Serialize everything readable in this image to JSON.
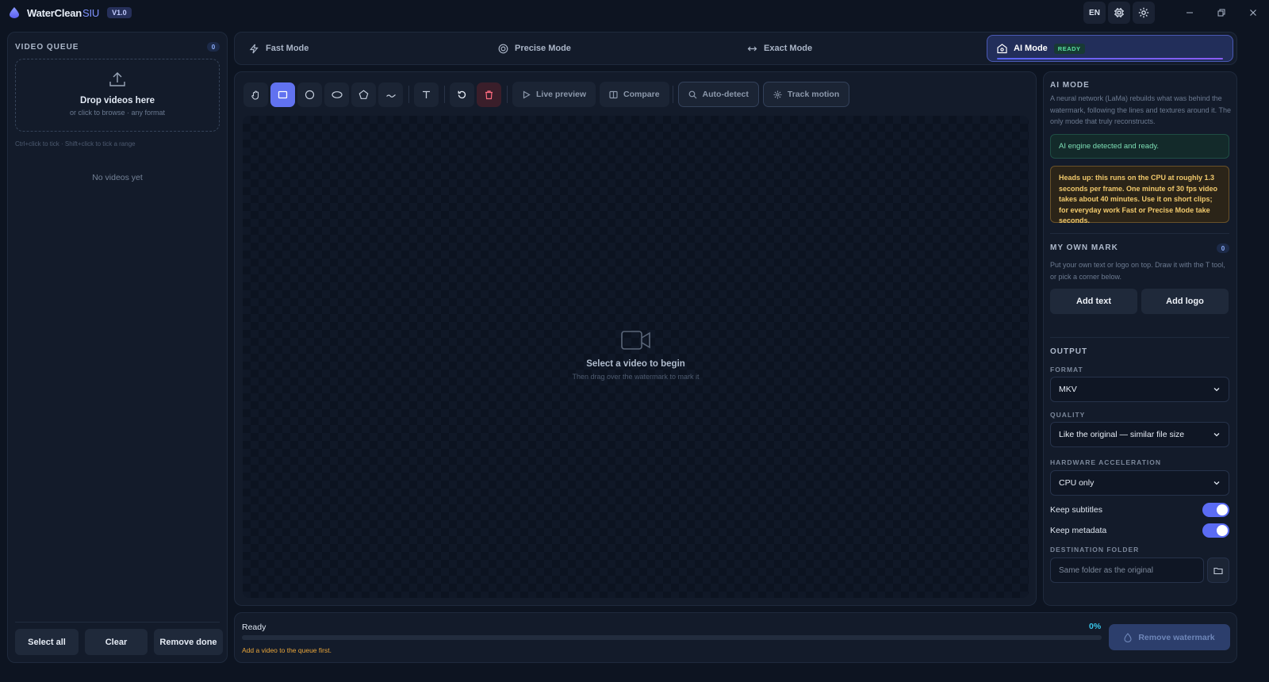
{
  "app": {
    "name": "WaterClean",
    "name_suffix": "SIU",
    "version": "V1.0",
    "language": "EN"
  },
  "queue": {
    "title": "VIDEO QUEUE",
    "count": "0",
    "drop_title": "Drop videos here",
    "drop_sub": "or click to browse · any format",
    "hint": "Ctrl+click to tick · Shift+click to tick a range",
    "empty": "No videos yet",
    "actions": {
      "select_all": "Select all",
      "clear": "Clear",
      "remove_done": "Remove done"
    }
  },
  "modes": {
    "fast": "Fast Mode",
    "precise": "Precise Mode",
    "exact": "Exact Mode",
    "ai": "AI Mode",
    "ai_badge": "READY"
  },
  "toolbar": {
    "live_preview": "Live preview",
    "compare": "Compare",
    "auto_detect": "Auto-detect",
    "track_motion": "Track motion"
  },
  "canvas": {
    "empty_title": "Select a video to begin",
    "empty_sub": "Then drag over the watermark to mark it"
  },
  "settings": {
    "ai_mode": {
      "title": "AI MODE",
      "description": "A neural network (LaMa) rebuilds what was behind the watermark, following the lines and textures around it. The only mode that truly reconstructs.",
      "status": "AI engine detected and ready.",
      "warning": "Heads up: this runs on the CPU at roughly 1.3 seconds per frame. One minute of 30 fps video takes about 40 minutes. Use it on short clips; for everyday work Fast or Precise Mode take seconds."
    },
    "own_mark": {
      "title": "MY OWN MARK",
      "count": "0",
      "description": "Put your own text or logo on top. Draw it with the T tool, or pick a corner below.",
      "add_text": "Add text",
      "add_logo": "Add logo"
    },
    "output": {
      "title": "OUTPUT",
      "format_label": "FORMAT",
      "format_value": "MKV",
      "quality_label": "QUALITY",
      "quality_value": "Like the original — similar file size",
      "hw_label": "HARDWARE ACCELERATION",
      "hw_value": "CPU only",
      "keep_subtitles": "Keep subtitles",
      "keep_metadata": "Keep metadata",
      "dest_label": "DESTINATION FOLDER",
      "dest_placeholder": "Same folder as the original"
    }
  },
  "status": {
    "text": "Ready",
    "percent": "0%",
    "progress": 0,
    "hint": "Add a video to the queue first.",
    "remove_button": "Remove watermark"
  },
  "colors": {
    "accent": "#5b6cf4",
    "progress": "#38c6ea",
    "success": "#7ee0b6",
    "warning": "#f1c96c"
  }
}
